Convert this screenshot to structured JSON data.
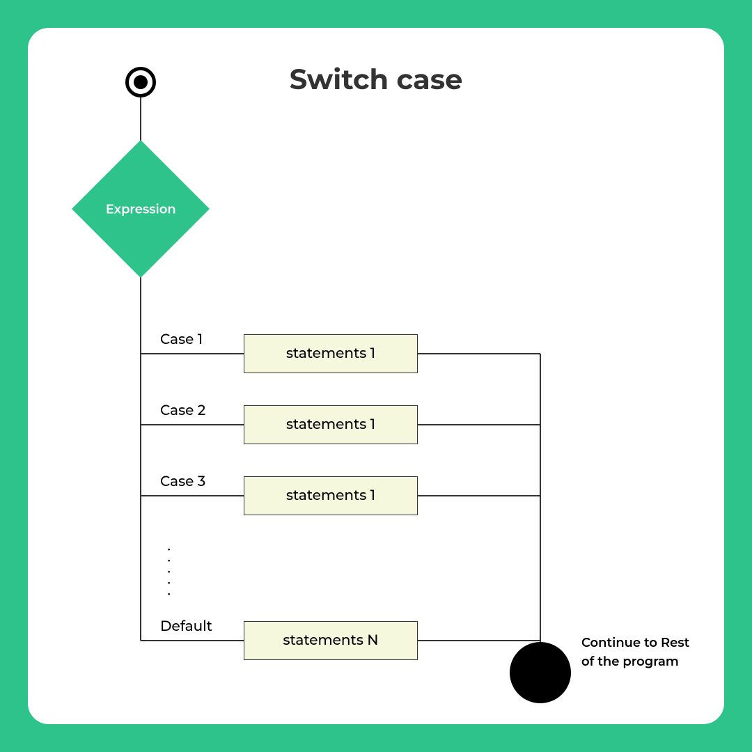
{
  "title": "Switch case",
  "decision": "Expression",
  "cases": [
    {
      "label": "Case 1",
      "statement": "statements 1"
    },
    {
      "label": "Case 2",
      "statement": "statements 1"
    },
    {
      "label": "Case 3",
      "statement": "statements 1"
    },
    {
      "label": "Default",
      "statement": "statements N"
    }
  ],
  "end_label_line1": "Continue to Rest",
  "end_label_line2": "of the program",
  "colors": {
    "accent": "#2dc38a",
    "statement_fill": "#f6f8dd"
  }
}
